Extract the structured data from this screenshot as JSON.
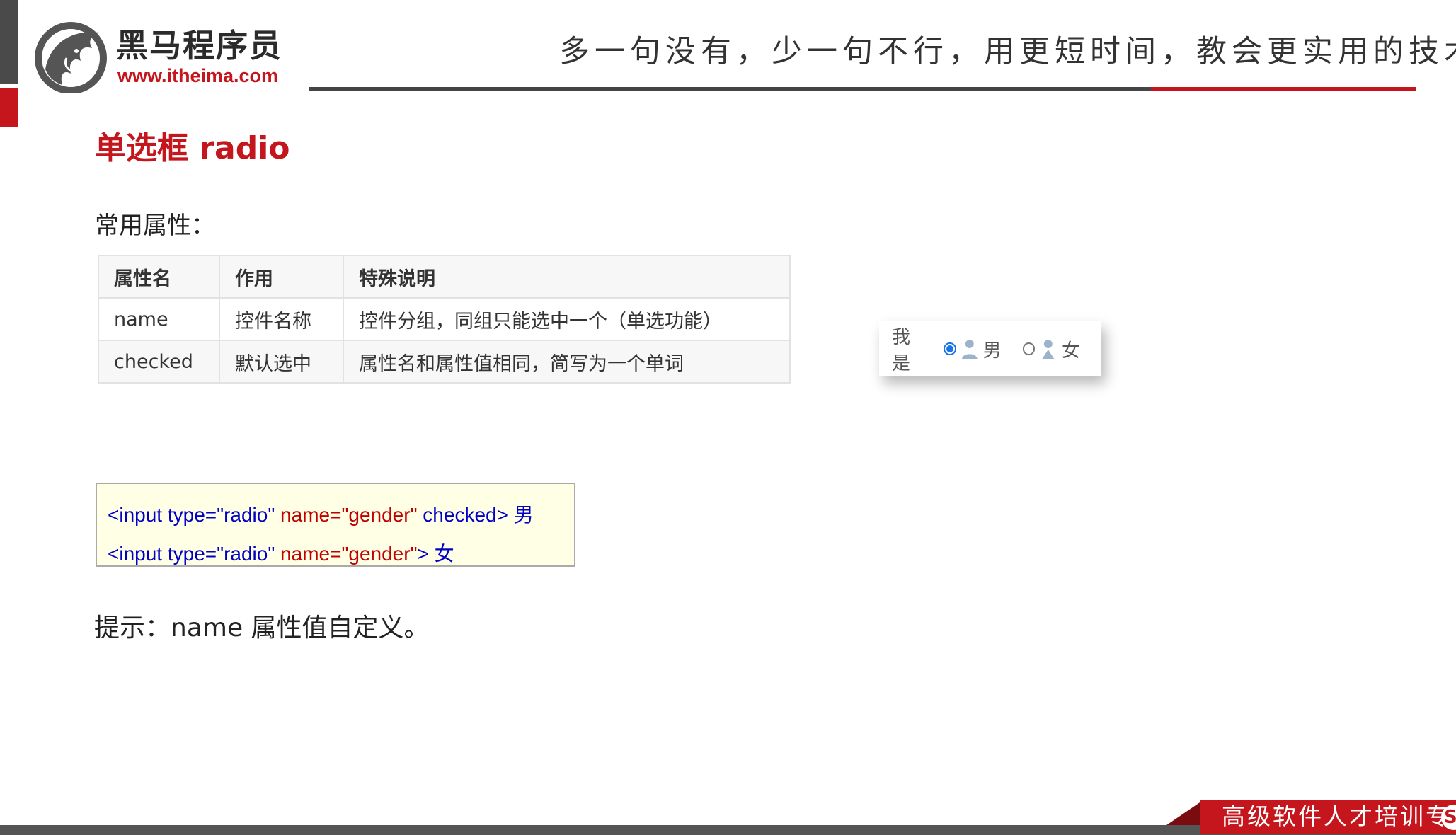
{
  "header": {
    "brand_name": "黑马程序员",
    "brand_url": "www.itheima.com",
    "slogan": "多一句没有，少一句不行，用更短时间，教会更实用的技术！"
  },
  "main": {
    "title": "单选框 radio",
    "section_label": "常用属性：",
    "table": {
      "headers": [
        "属性名",
        "作用",
        "特殊说明"
      ],
      "rows": [
        [
          "name",
          "控件名称",
          "控件分组，同组只能选中一个（单选功能）"
        ],
        [
          "checked",
          "默认选中",
          "属性名和属性值相同，简写为一个单词"
        ]
      ]
    },
    "demo": {
      "label": "我是",
      "options": [
        {
          "text": "男",
          "checked": true
        },
        {
          "text": "女",
          "checked": false
        }
      ]
    },
    "code": {
      "line1": {
        "tag": "<input type=\"radio\"",
        "attr": "name=\"gender\"",
        "rest": "checked>",
        "text": "男"
      },
      "line2": {
        "tag": "<input type=\"radio\"",
        "attr": "name=\"gender\"",
        "rest": ">",
        "text": "女"
      }
    },
    "hint": "提示：name 属性值自定义。"
  },
  "footer": {
    "text": "高级软件人才培训专",
    "logo_glyph": "S"
  },
  "colors": {
    "accent_red": "#c4161c",
    "dark_gray": "#454545",
    "code_bg": "#ffffe6",
    "radio_blue": "#1a73e8"
  }
}
